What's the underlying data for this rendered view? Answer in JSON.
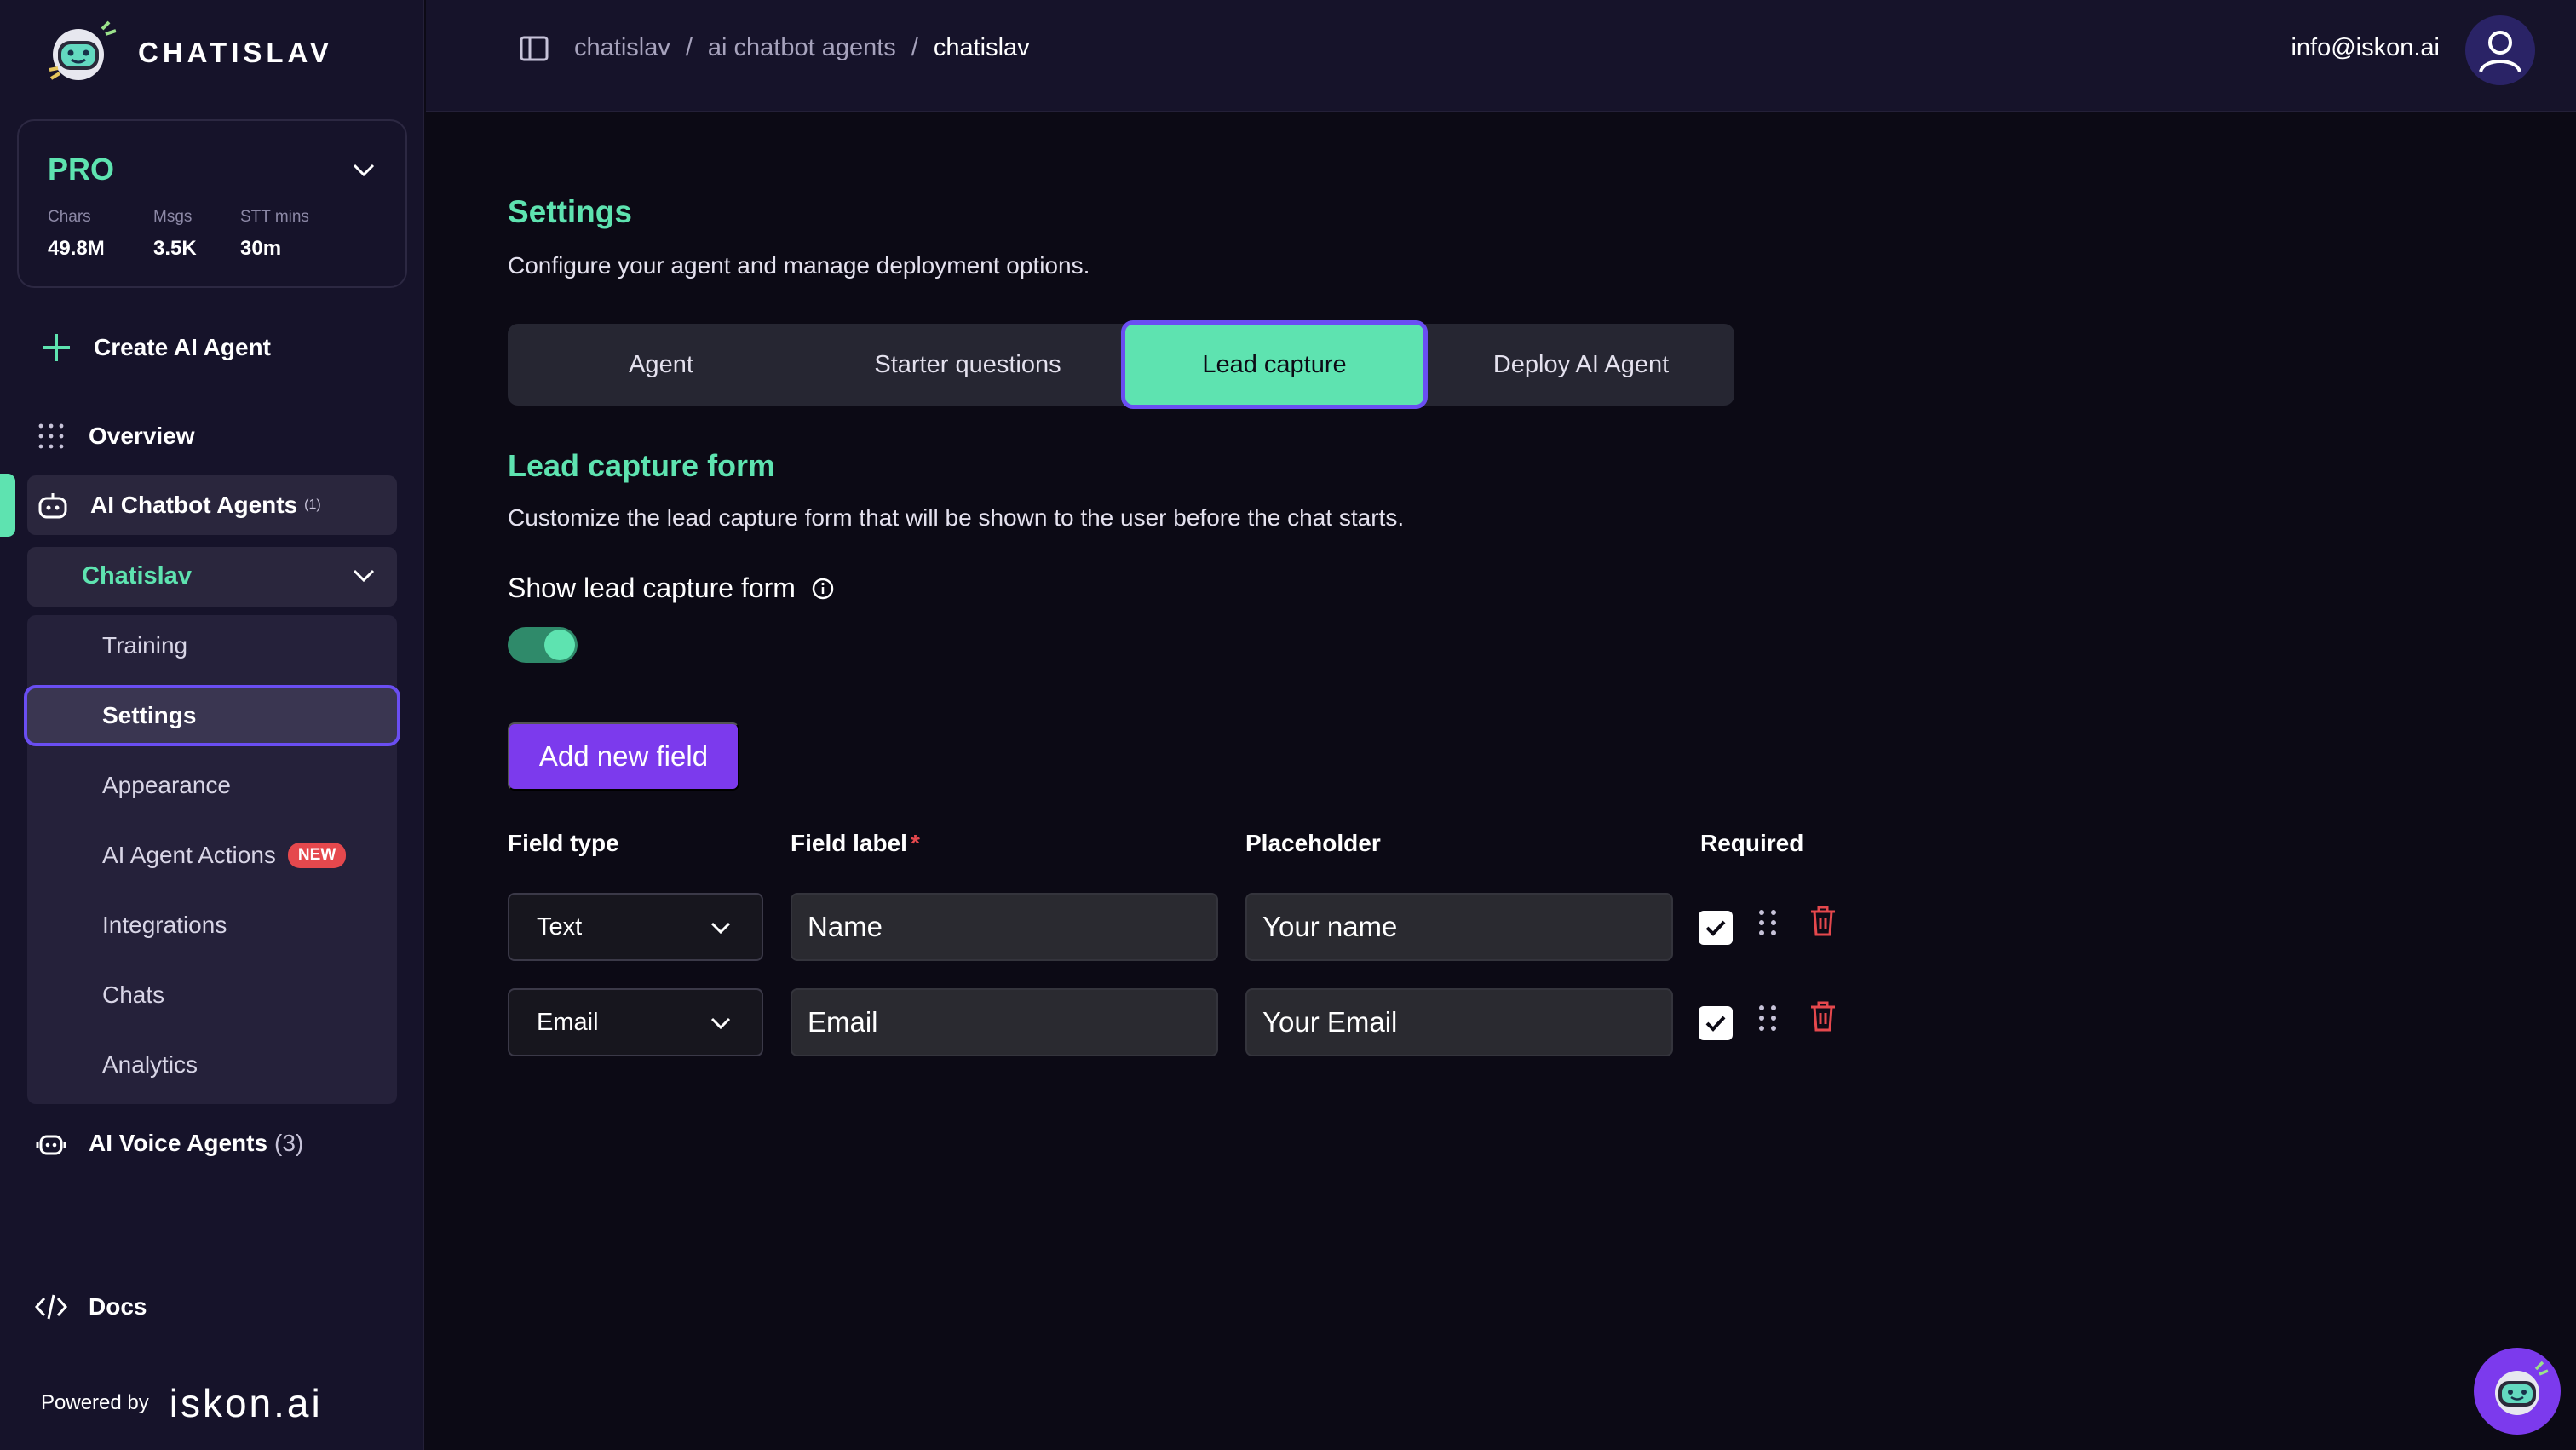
{
  "brand": {
    "name": "CHATISLAV"
  },
  "plan": {
    "name": "PRO",
    "stats": [
      {
        "label": "Chars",
        "value": "49.8M"
      },
      {
        "label": "Msgs",
        "value": "3.5K"
      },
      {
        "label": "STT mins",
        "value": "30m"
      }
    ]
  },
  "sidebar": {
    "create_label": "Create AI Agent",
    "overview_label": "Overview",
    "chatbot_agents_label": "AI Chatbot Agents",
    "chatbot_agents_count": "(1)",
    "agent_name": "Chatislav",
    "submenu": [
      {
        "label": "Training"
      },
      {
        "label": "Settings"
      },
      {
        "label": "Appearance"
      },
      {
        "label": "AI Agent Actions",
        "badge": "NEW"
      },
      {
        "label": "Integrations"
      },
      {
        "label": "Chats"
      },
      {
        "label": "Analytics"
      }
    ],
    "voice_agents_label": "AI Voice Agents",
    "voice_agents_count": "(3)",
    "docs_label": "Docs",
    "powered_by": "Powered by",
    "powered_brand": "iskon.ai"
  },
  "header": {
    "breadcrumb": [
      "chatislav",
      "ai chatbot agents",
      "chatislav"
    ],
    "separator": "/",
    "user_email": "info@iskon.ai"
  },
  "settings": {
    "title": "Settings",
    "description": "Configure your agent and manage deployment options.",
    "tabs": [
      "Agent",
      "Starter questions",
      "Lead capture",
      "Deploy AI Agent"
    ],
    "active_tab": "Lead capture"
  },
  "lead_capture": {
    "title": "Lead capture form",
    "description": "Customize the lead capture form that will be shown to the user before the chat starts.",
    "toggle_label": "Show lead capture form",
    "toggle_on": true,
    "add_button": "Add new field",
    "columns": {
      "field_type": "Field type",
      "field_label": "Field label",
      "required_mark": "*",
      "placeholder": "Placeholder",
      "required": "Required"
    },
    "fields": [
      {
        "type": "Text",
        "label": "Name",
        "placeholder": "Your name",
        "required": true
      },
      {
        "type": "Email",
        "label": "Email",
        "placeholder": "Your Email",
        "required": true
      }
    ]
  },
  "colors": {
    "accent": "#5ee3b0",
    "primary": "#7c3aed",
    "danger": "#e5484d",
    "background": "#0c0a15"
  }
}
